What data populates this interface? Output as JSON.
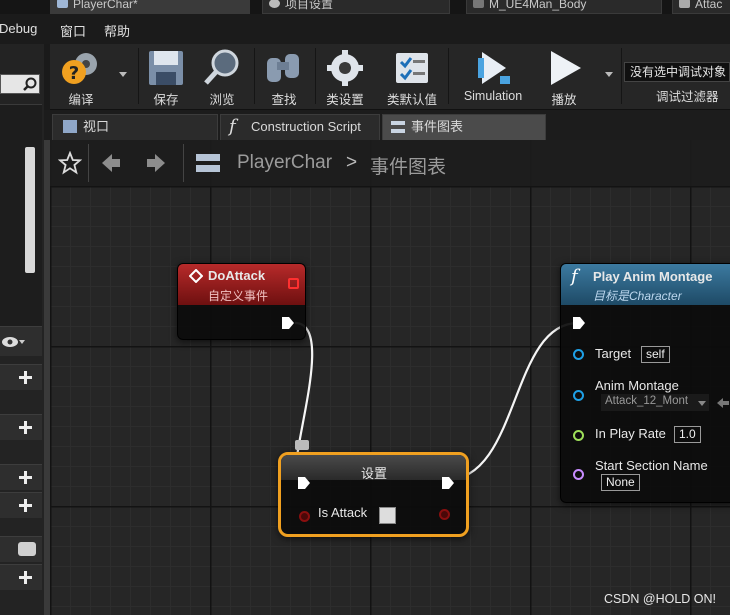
{
  "doc_tabs": {
    "playerchar": "PlayerChar*",
    "project_settings": "项目设置",
    "material": "M_UE4Man_Body",
    "attack": "Attac"
  },
  "menu": {
    "debug": "Debug",
    "window": "窗口",
    "help": "帮助"
  },
  "toolbar": {
    "compile": "编译",
    "save": "保存",
    "browse": "浏览",
    "find": "查找",
    "class_settings": "类设置",
    "class_defaults": "类默认值",
    "simulation": "Simulation",
    "play": "播放",
    "debug_filter_value": "没有选中调试对象",
    "debug_filter_label": "调试过滤器"
  },
  "editor_tabs": {
    "viewport": "视口",
    "construction_script": "Construction Script",
    "event_graph": "事件图表"
  },
  "breadcrumb": {
    "blueprint": "PlayerChar",
    "separator": ">",
    "graph": "事件图表"
  },
  "nodes": {
    "do_attack": {
      "title": "DoAttack",
      "subtitle": "自定义事件"
    },
    "set": {
      "title": "设置",
      "variable": "Is Attack"
    },
    "play_anim_montage": {
      "title": "Play Anim Montage",
      "subtitle": "目标是Character",
      "target_label": "Target",
      "target_value": "self",
      "montage_label": "Anim Montage",
      "montage_value": "Attack_12_Mont",
      "play_rate_label": "In Play Rate",
      "play_rate_value": "1.0",
      "section_label": "Start Section Name",
      "section_value": "None"
    }
  },
  "watermark": "CSDN @HOLD ON!",
  "colors": {
    "event_header": "#a02323",
    "function_header": "#2f6585",
    "exec_pin": "#ffffff",
    "object_pin": "#1ea0e6",
    "float_pin": "#9ee05a",
    "name_pin": "#c88cff",
    "bool_pin": "#8a0f0f",
    "selection": "#f0a020"
  }
}
